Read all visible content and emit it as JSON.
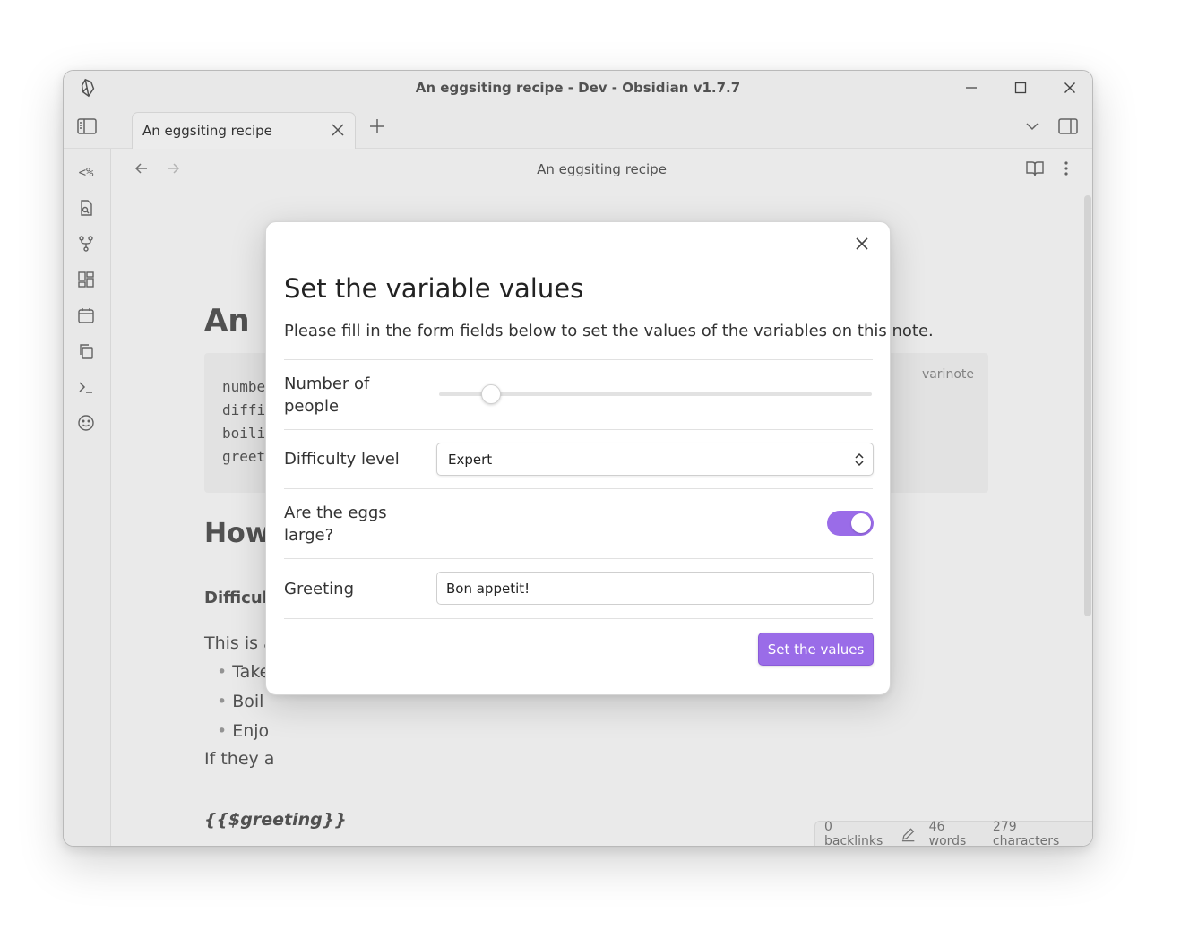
{
  "window": {
    "title": "An eggsiting recipe - Dev - Obsidian v1.7.7"
  },
  "tabs": [
    {
      "label": "An eggsiting recipe",
      "active": true
    }
  ],
  "ribbon": {
    "templater_label": "<%"
  },
  "editor": {
    "view_title": "An  eggsiting recipe",
    "note": {
      "heading1": "An",
      "code_block": {
        "lang": "varinote",
        "lines": [
          "numbe",
          "diffi",
          "boili",
          "greet"
        ]
      },
      "heading2": "How",
      "bold_line": "Difficul",
      "paragraph1": "This is a",
      "bullets": [
        "Take",
        "Boil",
        "Enjo"
      ],
      "paragraph2": "If they a",
      "greeting_var": "{{$greeting}}"
    }
  },
  "status_bar": {
    "backlinks": "0 backlinks",
    "words": "46 words",
    "characters": "279 characters"
  },
  "modal": {
    "title": "Set the variable values",
    "description": "Please fill in the form fields below to set the values of the variables on this note.",
    "fields": {
      "people_label": "Number of people",
      "people_slider_fraction": 0.12,
      "difficulty_label": "Difficulty level",
      "difficulty_value": "Expert",
      "large_label": "Are the eggs large?",
      "large_value": true,
      "greeting_label": "Greeting",
      "greeting_value": "Bon appetit!"
    },
    "submit_label": "Set the values"
  },
  "colors": {
    "accent": "#9a6ce8",
    "egg": "#e8b07c"
  }
}
